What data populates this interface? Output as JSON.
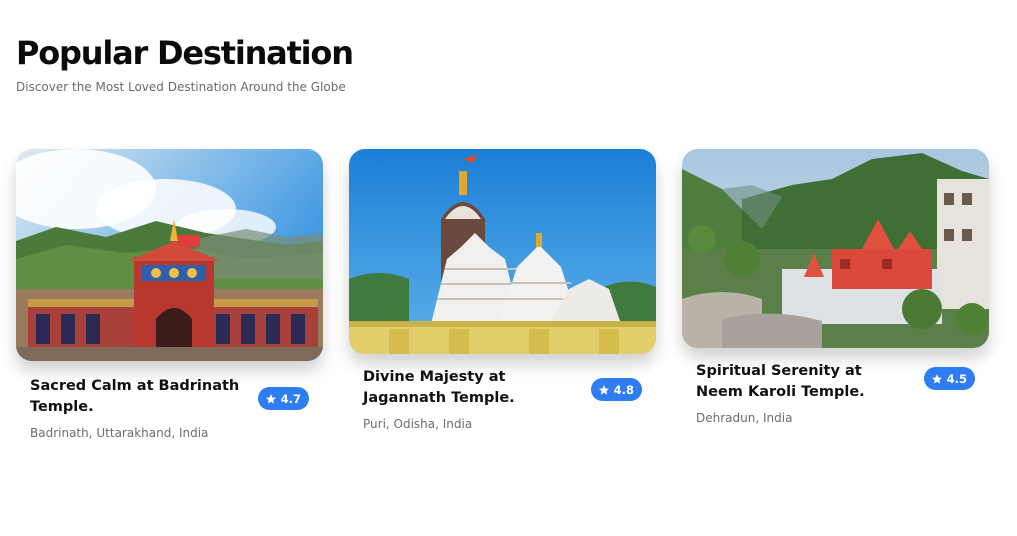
{
  "header": {
    "title": "Popular Destination",
    "subtitle": "Discover the Most Loved Destination Around the Globe"
  },
  "colors": {
    "accent": "#2f7df2",
    "heading": "#0b0b0b",
    "muted": "#6d6d6d"
  },
  "cards": [
    {
      "image": "badrinath-temple-photo",
      "title": "Sacred Calm at Badrinath Temple.",
      "location": "Badrinath, Uttarakhand, India",
      "rating": "4.7",
      "rating_icon": "star-icon"
    },
    {
      "image": "jagannath-temple-photo",
      "title": "Divine Majesty at Jagannath Temple.",
      "location": "Puri, Odisha, India",
      "rating": "4.8",
      "rating_icon": "star-icon"
    },
    {
      "image": "neem-karoli-temple-photo",
      "title": "Spiritual Serenity at Neem Karoli Temple.",
      "location": "Dehradun, India",
      "rating": "4.5",
      "rating_icon": "star-icon"
    }
  ]
}
